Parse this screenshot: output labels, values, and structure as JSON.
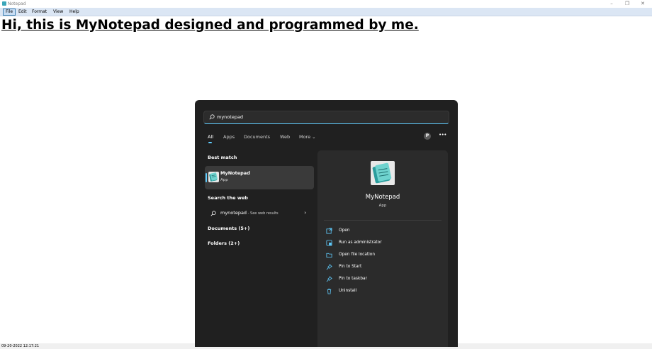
{
  "window": {
    "title": "Notepad",
    "minimize": "–",
    "restore": "❐",
    "close": "✕"
  },
  "menubar": [
    "File",
    "Edit",
    "Format",
    "View",
    "Help"
  ],
  "document": {
    "text": "Hi, this is MyNotepad designed and programmed by me."
  },
  "status": {
    "datetime": "09-20-2022  12:17:21"
  },
  "start_menu": {
    "search_value": "mynotepad",
    "tabs": [
      "All",
      "Apps",
      "Documents",
      "Web",
      "More ⌄"
    ],
    "avatar_initial": "P",
    "more_options": "•••",
    "best_match_heading": "Best match",
    "best_match": {
      "name": "MyNotepad",
      "type": "App"
    },
    "search_web_heading": "Search the web",
    "web_result": {
      "query": "mynotepad",
      "suffix": " - See web results",
      "chevron": "›"
    },
    "documents": "Documents (5+)",
    "folders": "Folders (2+)",
    "detail": {
      "name": "MyNotepad",
      "type": "App",
      "actions": [
        {
          "label": "Open",
          "icon": "open-icon"
        },
        {
          "label": "Run as administrator",
          "icon": "admin-icon"
        },
        {
          "label": "Open file location",
          "icon": "folder-icon"
        },
        {
          "label": "Pin to Start",
          "icon": "pin-icon"
        },
        {
          "label": "Pin to taskbar",
          "icon": "pin-icon"
        },
        {
          "label": "Uninstall",
          "icon": "trash-icon"
        }
      ]
    }
  },
  "colors": {
    "accent": "#60cdff",
    "panel": "#202020",
    "detail_panel": "#2b2b2b",
    "menubar": "#dbe6f4"
  }
}
